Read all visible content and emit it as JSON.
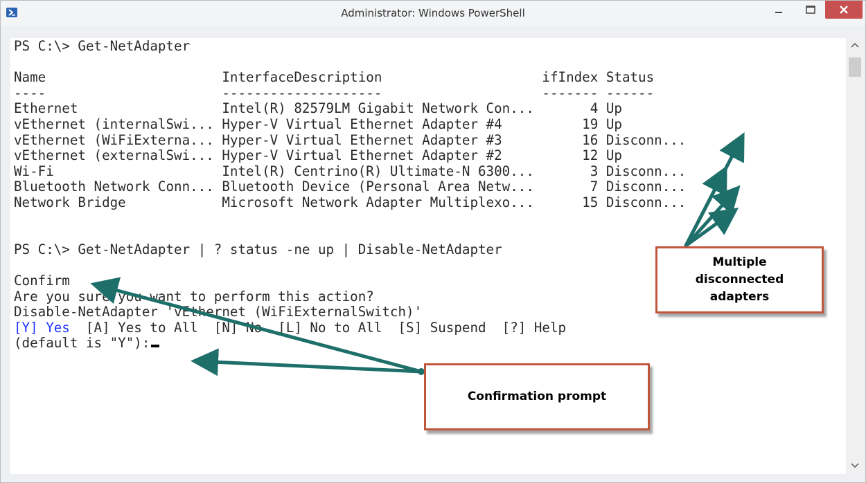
{
  "window": {
    "title": "Administrator: Windows PowerShell",
    "icon": "powershell-icon",
    "controls": [
      "minimize-icon",
      "maximize-icon",
      "close-icon"
    ],
    "close_color": "#c75050"
  },
  "console": {
    "prompt1": "PS C:\\> Get-NetAdapter",
    "table_header": "Name                      InterfaceDescription                    ifIndex Status",
    "table_separator": "----                      --------------------                    ------- ------",
    "rows": [
      "Ethernet                  Intel(R) 82579LM Gigabit Network Con...       4 Up",
      "vEthernet (internalSwi... Hyper-V Virtual Ethernet Adapter #4          19 Up",
      "vEthernet (WiFiExterna... Hyper-V Virtual Ethernet Adapter #3          16 Disconn...",
      "vEthernet (externalSwi... Hyper-V Virtual Ethernet Adapter #2          12 Up",
      "Wi-Fi                     Intel(R) Centrino(R) Ultimate-N 6300...       3 Disconn...",
      "Bluetooth Network Conn... Bluetooth Device (Personal Area Netw...       7 Disconn...",
      "Network Bridge            Microsoft Network Adapter Multiplexo...      15 Disconn..."
    ],
    "prompt2": "PS C:\\> Get-NetAdapter | ? status -ne up | Disable-NetAdapter",
    "confirm_title": "Confirm",
    "confirm_question": "Are you sure you want to perform this action?",
    "confirm_target": "Disable-NetAdapter 'vEthernet (WiFiExternalSwitch)'",
    "choice_default": "[Y] Yes",
    "choices_rest": "  [A] Yes to All  [N] No  [L] No to All  [S] Suspend  [?] Help",
    "default_prompt": "(default is \"Y\"):",
    "highlight_color": "#1f35ff"
  },
  "annotations": {
    "adapters_callout": "Multiple disconnected adapters",
    "confirm_callout": "Confirmation prompt",
    "arrow_color": "#1e6e6a",
    "border_color": "#c0563b"
  }
}
